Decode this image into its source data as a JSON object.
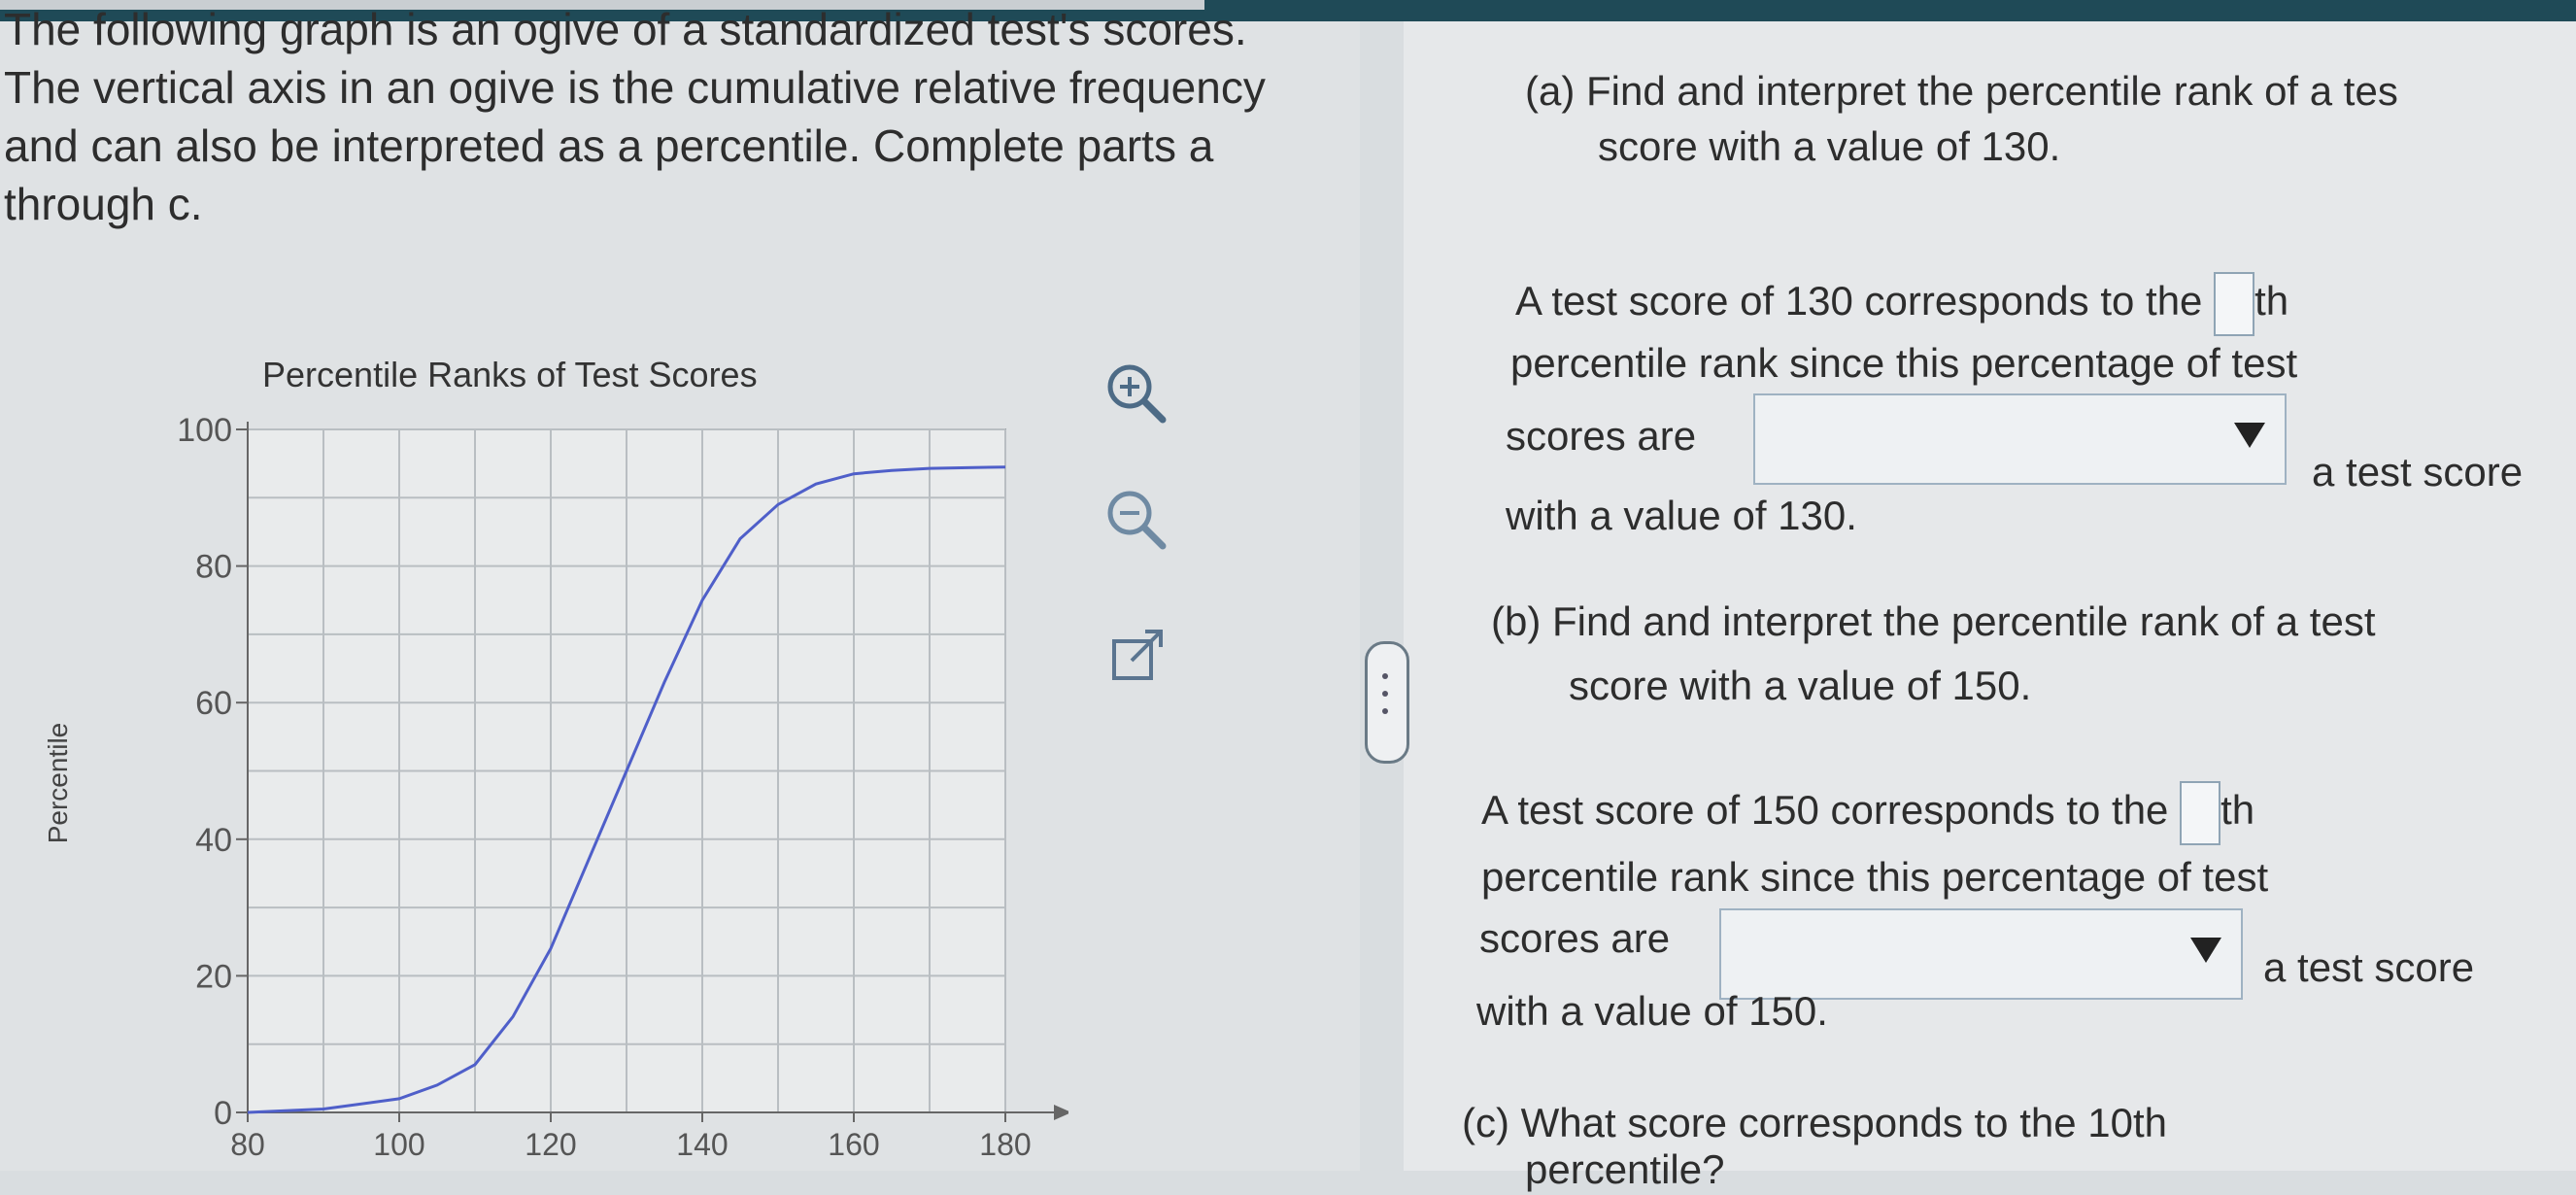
{
  "intro_text": "The following graph is an ogive of a standardized test's scores. The vertical axis in an ogive is the cumulative relative frequency and can also be interpreted as a percentile. Complete parts a through c.",
  "chart_data": {
    "type": "line",
    "title": "Percentile Ranks of Test Scores",
    "ylabel": "Percentile",
    "xlabel": "",
    "xlim": [
      80,
      180
    ],
    "ylim": [
      0,
      100
    ],
    "x_ticks": [
      "80",
      "100",
      "120",
      "140",
      "160",
      "180"
    ],
    "y_ticks": [
      "0",
      "20",
      "40",
      "60",
      "80",
      "100"
    ],
    "grid": true,
    "series": [
      {
        "x": [
          80,
          90,
          100,
          105,
          110,
          115,
          120,
          125,
          130,
          135,
          140,
          145,
          150,
          155,
          160,
          165,
          170,
          175,
          180
        ],
        "y": [
          0,
          0.5,
          2,
          4,
          7,
          14,
          24,
          37,
          50,
          63,
          75,
          84,
          89,
          92,
          93.5,
          94,
          94.3,
          94.4,
          94.5
        ],
        "color": "#4f5fc9"
      }
    ]
  },
  "tools": {
    "zoom_in": "zoom-in-icon",
    "zoom_out": "zoom-out-icon",
    "popout": "popout-icon"
  },
  "part_a": {
    "heading": "(a) Find and interpret the percentile rank of a tes",
    "heading2": "score with a value of 130.",
    "line1": "A test score of 130 corresponds to the",
    "suffix1": "th",
    "line2": "percentile rank since this percentage of test",
    "line3_pre": "scores are",
    "line3_post": "a test score",
    "line4": "with a value of 130."
  },
  "part_b": {
    "heading": "(b) Find and interpret the percentile rank of a test",
    "heading2": "score with a value of 150.",
    "line1": "A test score of 150 corresponds to the",
    "suffix1": "th",
    "line2": "percentile rank since this percentage of test",
    "line3_pre": "scores are",
    "line3_post": "a test score",
    "line4": "with a value of 150."
  },
  "part_c": {
    "heading": "(c) What score corresponds to the 10th",
    "heading2": "percentile?"
  }
}
